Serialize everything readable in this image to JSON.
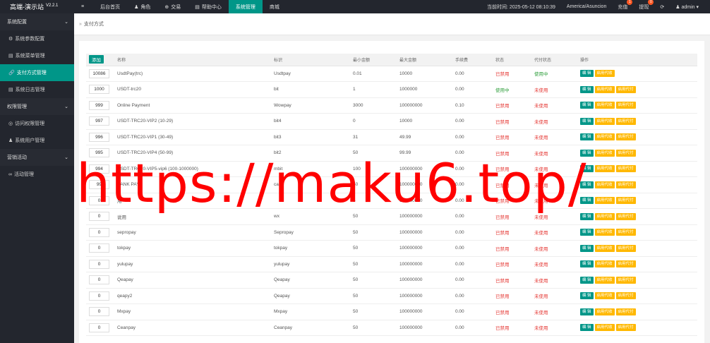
{
  "app": {
    "title": "高端-演示站",
    "version": "V2.2.1"
  },
  "topnav": [
    {
      "icon": "≡",
      "label": ""
    },
    {
      "icon": "",
      "label": "后台首页"
    },
    {
      "icon": "♟",
      "label": "角色"
    },
    {
      "icon": "⊕",
      "label": "交易"
    },
    {
      "icon": "▤",
      "label": "帮助中心"
    },
    {
      "icon": "",
      "label": "系统管理"
    },
    {
      "icon": "",
      "label": "商城"
    }
  ],
  "topright": {
    "time_label": "当前时间: 2025-05-12 08:10:39",
    "timezone": "America/Asuncion",
    "recharge_label": "充值",
    "recharge_badge": "1",
    "withdraw_label": "提现",
    "withdraw_badge": "0",
    "refresh_icon": "⟳",
    "user_label": "admin"
  },
  "sidebar": [
    {
      "type": "group",
      "label": "系统配置"
    },
    {
      "type": "item",
      "icon": "⚙",
      "label": "系统参数配置"
    },
    {
      "type": "item",
      "icon": "▤",
      "label": "系统菜单管理"
    },
    {
      "type": "item",
      "icon": "🔗",
      "label": "支付方式管理",
      "active": true
    },
    {
      "type": "item",
      "icon": "▤",
      "label": "系统日志管理"
    },
    {
      "type": "group",
      "label": "权限管理"
    },
    {
      "type": "item",
      "icon": "◎",
      "label": "访问权限管理"
    },
    {
      "type": "item",
      "icon": "♟",
      "label": "系统用户管理"
    },
    {
      "type": "group",
      "label": "营销活动"
    },
    {
      "type": "item",
      "icon": "∞",
      "label": "活动管理"
    }
  ],
  "breadcrumb": {
    "sep": "»",
    "label": "支付方式"
  },
  "table": {
    "add_label": "添加",
    "headers": [
      "名称",
      "标识",
      "最小金额",
      "最大金额",
      "手续费",
      "状态",
      "代付状态",
      "操作"
    ],
    "buttons": {
      "edit": "编 辑",
      "enable_pay": "启用代收",
      "enable_payout": "启用代付"
    },
    "rows": [
      {
        "sort": "10086",
        "name": "UsdtPay(trc)",
        "code": "Usdtpay",
        "min": "0.01",
        "max": "10000",
        "fee": "0.00",
        "status": "已禁用",
        "status_on": false,
        "payout": "使用中",
        "payout_on": true,
        "btns": 2
      },
      {
        "sort": "1000",
        "name": "USDT-trc20",
        "code": "bit",
        "min": "1",
        "max": "1000000",
        "fee": "0.00",
        "status": "使用中",
        "status_on": true,
        "payout": "未使用",
        "payout_on": false,
        "btns": 3
      },
      {
        "sort": "999",
        "name": "Online Payment",
        "code": "Wowpay",
        "min": "3000",
        "max": "100000000",
        "fee": "0.10",
        "status": "已禁用",
        "status_on": false,
        "payout": "未使用",
        "payout_on": false,
        "btns": 3
      },
      {
        "sort": "997",
        "name": "USDT-TRC20-VIP2 (10-29)",
        "code": "bit4",
        "min": "0",
        "max": "10000",
        "fee": "0.00",
        "status": "已禁用",
        "status_on": false,
        "payout": "未使用",
        "payout_on": false,
        "btns": 3
      },
      {
        "sort": "996",
        "name": "USDT-TRC20-VIP1 (30-49)",
        "code": "bit3",
        "min": "31",
        "max": "49.99",
        "fee": "0.00",
        "status": "已禁用",
        "status_on": false,
        "payout": "未使用",
        "payout_on": false,
        "btns": 3
      },
      {
        "sort": "995",
        "name": "USDT-TRC20-VIP4 (50-99)",
        "code": "bit2",
        "min": "50",
        "max": "99.99",
        "fee": "0.00",
        "status": "已禁用",
        "status_on": false,
        "payout": "未使用",
        "payout_on": false,
        "btns": 3
      },
      {
        "sort": "994",
        "name": "USDT-TRC20-VIP5-vip6 (100-1000000)",
        "code": "mbit",
        "min": "100",
        "max": "100000000",
        "fee": "0.00",
        "status": "已禁用",
        "status_on": false,
        "payout": "未使用",
        "payout_on": false,
        "btns": 3
      },
      {
        "sort": "99",
        "name": "BANK PAY",
        "code": "ca",
        "min": "50",
        "max": "100000000",
        "fee": "0.00",
        "status": "已禁用",
        "status_on": false,
        "payout": "未使用",
        "payout_on": false,
        "btns": 3
      },
      {
        "sort": "0",
        "name": "用",
        "code": "",
        "min": "5",
        "max": "100000000",
        "fee": "0.00",
        "status": "已禁用",
        "status_on": false,
        "payout": "未使用",
        "payout_on": false,
        "btns": 3
      },
      {
        "sort": "0",
        "name": "说用",
        "code": "wx",
        "min": "50",
        "max": "100000000",
        "fee": "0.00",
        "status": "已禁用",
        "status_on": false,
        "payout": "未使用",
        "payout_on": false,
        "btns": 3
      },
      {
        "sort": "0",
        "name": "sepropay",
        "code": "Sepropay",
        "min": "50",
        "max": "100000000",
        "fee": "0.00",
        "status": "已禁用",
        "status_on": false,
        "payout": "未使用",
        "payout_on": false,
        "btns": 3
      },
      {
        "sort": "0",
        "name": "tokpay",
        "code": "tokpay",
        "min": "50",
        "max": "100000000",
        "fee": "0.00",
        "status": "已禁用",
        "status_on": false,
        "payout": "未使用",
        "payout_on": false,
        "btns": 3
      },
      {
        "sort": "0",
        "name": "yulupay",
        "code": "yulupay",
        "min": "50",
        "max": "100000000",
        "fee": "0.00",
        "status": "已禁用",
        "status_on": false,
        "payout": "未使用",
        "payout_on": false,
        "btns": 3
      },
      {
        "sort": "0",
        "name": "Qeapay",
        "code": "Qeapay",
        "min": "50",
        "max": "100000000",
        "fee": "0.00",
        "status": "已禁用",
        "status_on": false,
        "payout": "未使用",
        "payout_on": false,
        "btns": 3
      },
      {
        "sort": "0",
        "name": "qeapy2",
        "code": "Qeapay",
        "min": "50",
        "max": "100000000",
        "fee": "0.00",
        "status": "已禁用",
        "status_on": false,
        "payout": "未使用",
        "payout_on": false,
        "btns": 3
      },
      {
        "sort": "0",
        "name": "Mxpay",
        "code": "Mxpay",
        "min": "50",
        "max": "100000000",
        "fee": "0.00",
        "status": "已禁用",
        "status_on": false,
        "payout": "未使用",
        "payout_on": false,
        "btns": 3
      },
      {
        "sort": "0",
        "name": "Ceanpay",
        "code": "Ceanpay",
        "min": "50",
        "max": "100000000",
        "fee": "0.00",
        "status": "已禁用",
        "status_on": false,
        "payout": "未使用",
        "payout_on": false,
        "btns": 3
      }
    ]
  },
  "watermark": "https://maku6.top/",
  "colors": {
    "accent": "#009688",
    "sidebar_bg": "#23262e",
    "warn": "#ffb800",
    "danger": "#e53935",
    "success": "#2e9e3b",
    "watermark": "#ff0000"
  }
}
